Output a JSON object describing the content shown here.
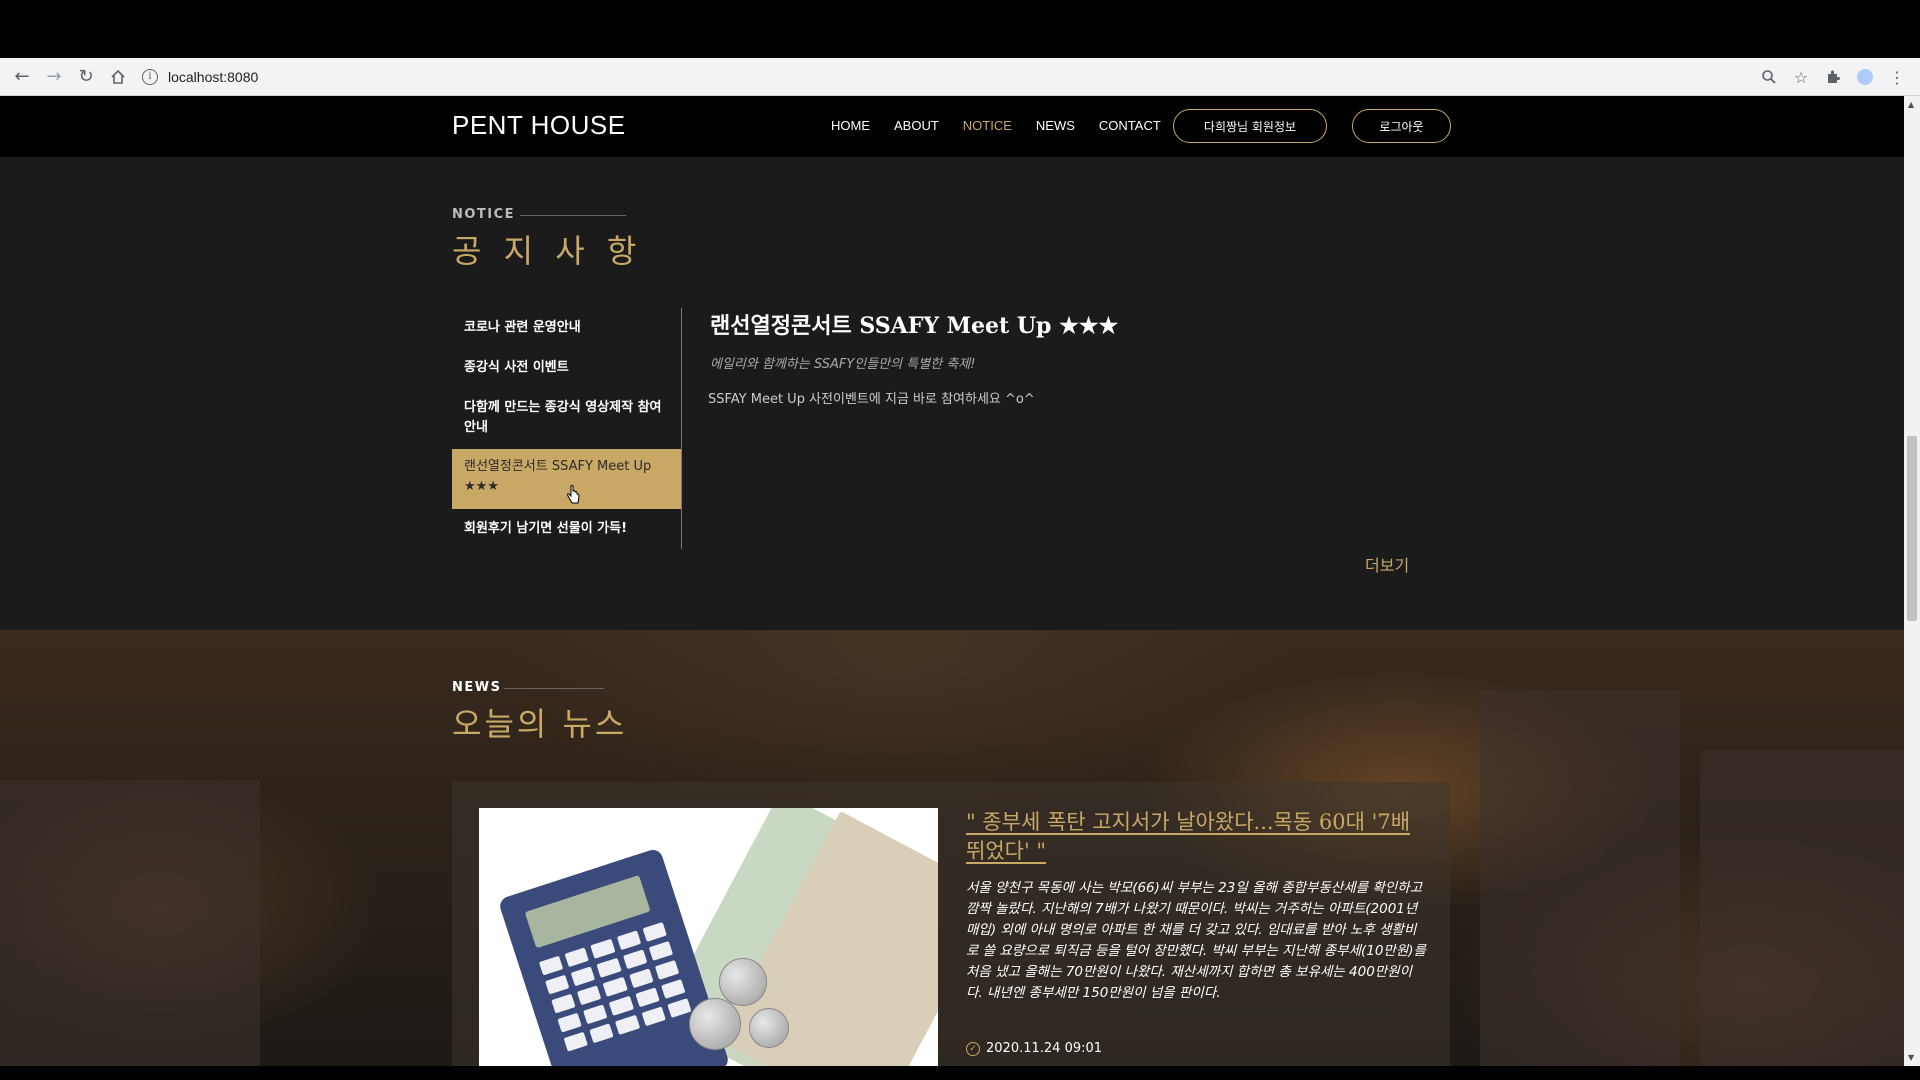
{
  "browser": {
    "url": "localhost:8080",
    "back_icon": "arrow-left-icon",
    "forward_icon": "arrow-right-icon",
    "reload_icon": "reload-icon",
    "home_icon": "home-icon"
  },
  "header": {
    "logo": "PENT HOUSE",
    "menu": [
      "HOME",
      "ABOUT",
      "NOTICE",
      "NEWS",
      "CONTACT"
    ],
    "active_menu": "NOTICE",
    "member_button": "다희짱님 회원정보",
    "logout_button": "로그아웃"
  },
  "notice": {
    "kicker": "NOTICE",
    "title": "공 지 사 항",
    "items": [
      "코로나 관련 운영안내",
      "종강식 사전 이벤트",
      "다함께 만드는 종강식 영상제작 참여안내",
      "랜선열정콘서트 SSAFY Meet Up ★★★",
      "회원후기 남기면 선물이 가득!"
    ],
    "selected_index": 3,
    "detail": {
      "title": "랜선열정콘서트 SSAFY Meet Up ★★★",
      "subtitle": "에일리와 함께하는 SSAFY인들만의 특별한 축제!",
      "body": "SSFAY Meet Up 사전이벤트에 지금 바로 참여하세요 ^o^"
    },
    "more": "더보기"
  },
  "news": {
    "kicker": "NEWS",
    "title": "오늘의 뉴스",
    "article": {
      "headline": "\" 종부세 폭탄 고지서가 날아왔다...목동 60대 '7배 뛰었다' \"",
      "body": "서울 양천구 목동에 사는 박모(66)씨 부부는 23일 올해 종합부동산세를 확인하고 깜짝 놀랐다. 지난해의 7배가 나왔기 때문이다. 박씨는 거주하는 아파트(2001년 매입) 외에 아내 명의로 아파트 한 채를 더 갖고 있다. 임대료를 받아 노후 생활비로 쓸 요량으로 퇴직금 등을 털어 장만했다. 박씨 부부는 지난해 종부세(10만원)를 처음 냈고 올해는 70만원이 나왔다. 재산세까지 합하면 총 보유세는 400만원이다. 내년엔 종부세만 150만원이 넘을 판이다.",
      "date": "2020.11.24 09:01"
    }
  },
  "colors": {
    "accent": "#c9a866",
    "header_bg": "#000000",
    "section_bg": "#1b1b1b"
  }
}
